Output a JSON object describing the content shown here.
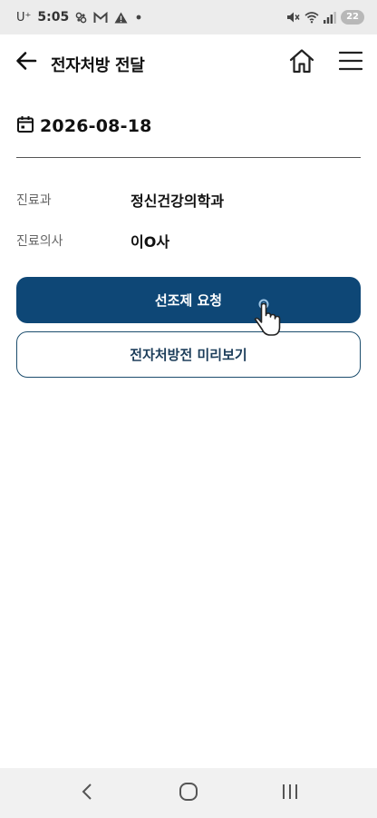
{
  "status_bar": {
    "carrier": "U⁺",
    "time": "5:05",
    "battery": "22",
    "left_icons": [
      "link-icon",
      "gmail-icon",
      "warning-icon",
      "dot-icon"
    ],
    "right_icons": [
      "mute-icon",
      "wifi-icon",
      "signal-icon",
      "battery-icon"
    ]
  },
  "header": {
    "title": "전자처방 전달",
    "icons": [
      "back-arrow-icon",
      "home-icon",
      "menu-icon"
    ]
  },
  "prescription": {
    "date": "2026-08-18",
    "department_label": "진료과",
    "department_value": "정신건강의학과",
    "doctor_label": "진료의사",
    "doctor_value": "이O사"
  },
  "actions": {
    "primary_label": "선조제 요청",
    "secondary_label": "전자처방전 미리보기"
  },
  "nav_bar": {
    "icons": [
      "back-nav-icon",
      "home-nav-icon",
      "recents-nav-icon"
    ]
  },
  "colors": {
    "primary": "#0e4776",
    "secondary_border": "#1c4d6d",
    "status_bar_bg": "#ececec",
    "nav_bar_bg": "#f1f1f1"
  }
}
